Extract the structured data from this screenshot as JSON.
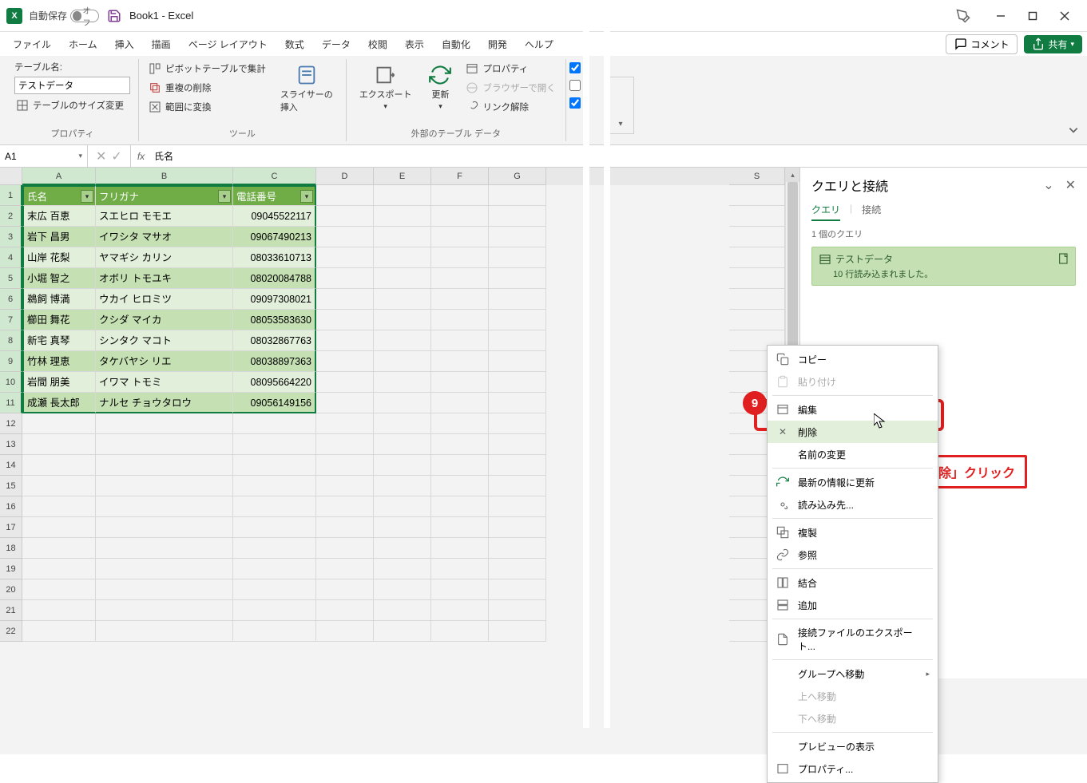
{
  "titlebar": {
    "autosave_label": "自動保存",
    "autosave_state": "オフ",
    "title": "Book1 - Excel"
  },
  "window_controls": {
    "minimize": "—",
    "maximize": "☐",
    "close": "✕"
  },
  "menutabs": {
    "items": [
      "ファイル",
      "ホーム",
      "挿入",
      "描画",
      "ページ レイアウト",
      "数式",
      "データ",
      "校閲",
      "表示",
      "自動化",
      "開発",
      "ヘルプ"
    ],
    "comment": "コメント",
    "share": "共有"
  },
  "ribbon": {
    "properties": {
      "label": "プロパティ",
      "table_name_label": "テーブル名:",
      "table_name": "テストデータ",
      "resize": "テーブルのサイズ変更"
    },
    "tools": {
      "label": "ツール",
      "pivot": "ピボットテーブルで集計",
      "dedupe": "重複の削除",
      "range": "範囲に変換",
      "slicer": "スライサーの\n挿入"
    },
    "external": {
      "label": "外部のテーブル データ",
      "export": "エクスポート",
      "refresh": "更新",
      "prop": "プロパティ",
      "browser": "ブラウザーで開く",
      "unlink": "リンク解除"
    }
  },
  "formula_bar": {
    "namebox": "A1",
    "value": "氏名"
  },
  "columns": [
    "A",
    "B",
    "C",
    "D",
    "E",
    "F",
    "G",
    "S"
  ],
  "table": {
    "headers": [
      "氏名",
      "フリガナ",
      "電話番号"
    ],
    "rows": [
      [
        "末広 百恵",
        "スエヒロ モモエ",
        "09045522117"
      ],
      [
        "岩下 昌男",
        "イワシタ マサオ",
        "09067490213"
      ],
      [
        "山岸 花梨",
        "ヤマギシ カリン",
        "08033610713"
      ],
      [
        "小堀 智之",
        "オボリ トモユキ",
        "08020084788"
      ],
      [
        "鵜飼 博満",
        "ウカイ ヒロミツ",
        "09097308021"
      ],
      [
        "櫛田 舞花",
        "クシダ マイカ",
        "08053583630"
      ],
      [
        "新宅 真琴",
        "シンタク マコト",
        "08032867763"
      ],
      [
        "竹林 理恵",
        "タケバヤシ リエ",
        "08038897363"
      ],
      [
        "岩間 朋美",
        "イワマ トモミ",
        "08095664220"
      ],
      [
        "成瀬 長太郎",
        "ナルセ チョウタロウ",
        "09056149156"
      ]
    ]
  },
  "empty_rows": [
    12,
    13,
    14,
    15,
    16,
    17,
    18,
    19,
    20,
    21,
    22
  ],
  "queries_pane": {
    "title": "クエリと接続",
    "tab_query": "クエリ",
    "tab_conn": "接続",
    "count": "1 個のクエリ",
    "query_name": "テストデータ",
    "query_status": "10 行読み込まれました。"
  },
  "context_menu": {
    "copy": "コピー",
    "paste": "貼り付け",
    "edit": "編集",
    "delete": "削除",
    "rename": "名前の変更",
    "refresh": "最新の情報に更新",
    "load_to": "読み込み先...",
    "duplicate": "複製",
    "reference": "参照",
    "merge": "結合",
    "append": "追加",
    "export_conn": "接続ファイルのエクスポート...",
    "move_group": "グループへ移動",
    "move_up": "上へ移動",
    "move_down": "下へ移動",
    "preview": "プレビューの表示",
    "properties": "プロパティ..."
  },
  "callouts": {
    "step": "9",
    "label": "「削除」クリック"
  }
}
